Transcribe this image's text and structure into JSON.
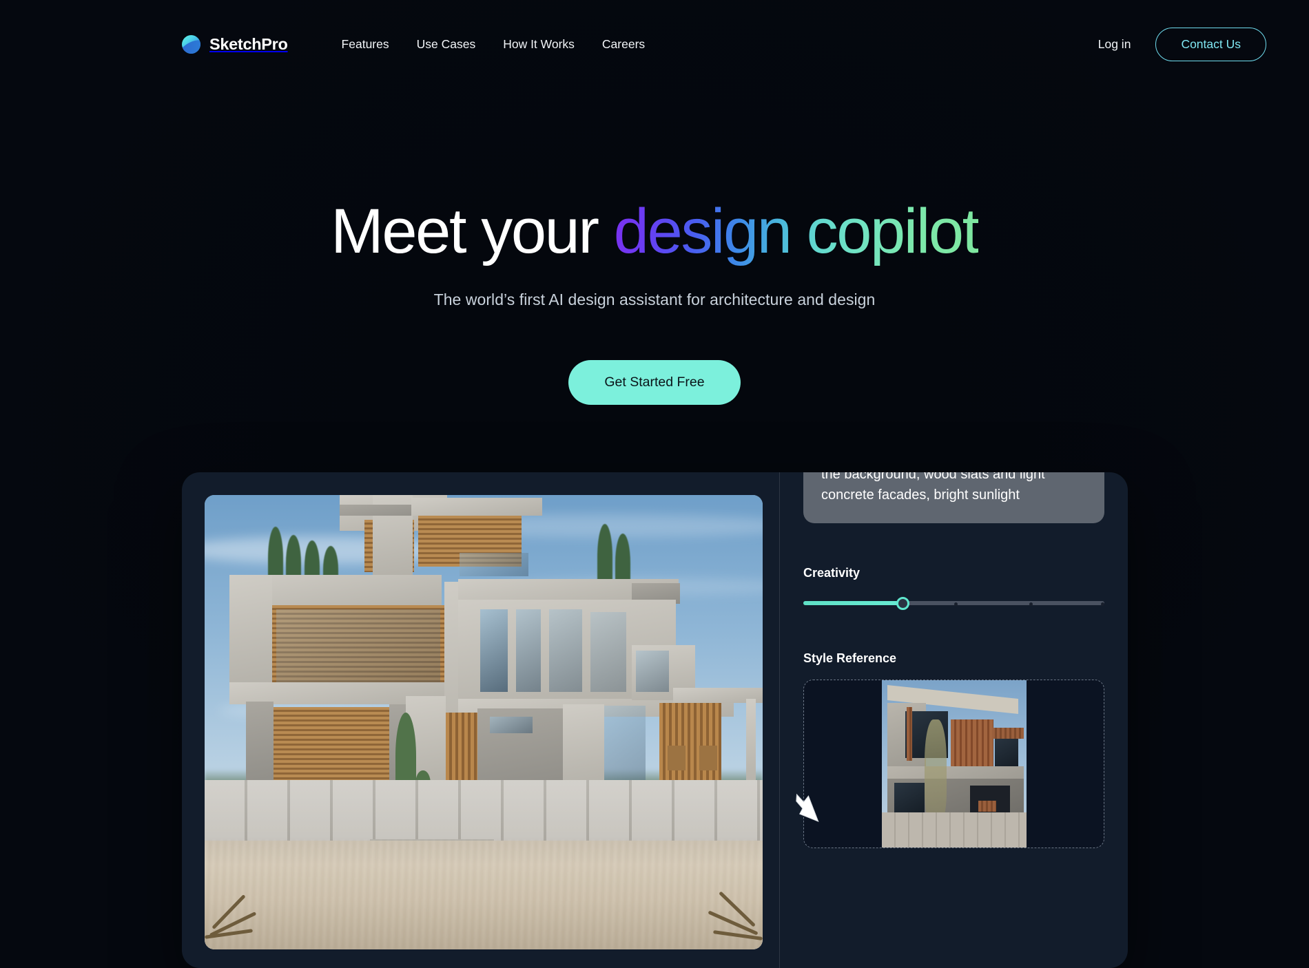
{
  "brand": {
    "name": "SketchPro",
    "logo_icon": "sketchpro-sphere-icon"
  },
  "nav": {
    "links": [
      {
        "label": "Features"
      },
      {
        "label": "Use Cases"
      },
      {
        "label": "How It Works"
      },
      {
        "label": "Careers"
      }
    ],
    "login_label": "Log in",
    "contact_label": "Contact Us"
  },
  "hero": {
    "headline_plain": "Meet your ",
    "headline_gradient": "design copilot",
    "subhead": "The world’s first AI design assistant for architecture and design",
    "cta_label": "Get Started Free"
  },
  "app": {
    "prompt_text_clipped": "the background, wood slats and light",
    "prompt_text": "concrete facades, bright sunlight",
    "creativity_label": "Creativity",
    "creativity_value": 33,
    "style_reference_label": "Style Reference",
    "render_alt": "modern-house-render",
    "style_thumb_alt": "modern-concrete-wood-house-thumbnail",
    "cursor_icon": "arrow-cursor"
  },
  "colors": {
    "accent_mint": "#7cf0dc",
    "accent_cyan": "#7fe6f2",
    "slider_fill": "#5fe6cd",
    "gradient_start": "#7b31f0",
    "gradient_end": "#7fe79f",
    "bg_blue": "#1747cf",
    "bg_teal": "#46d4e0"
  }
}
